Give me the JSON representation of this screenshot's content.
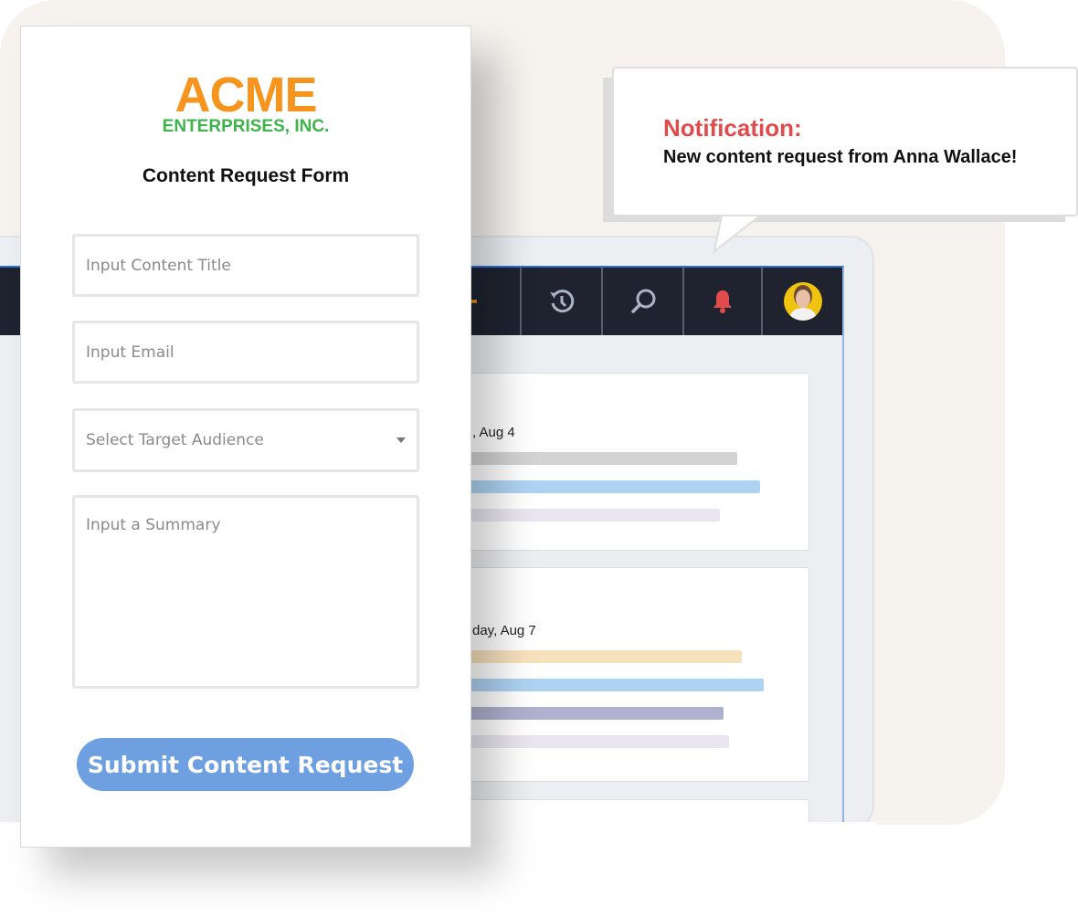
{
  "form": {
    "logo_main": "ACME",
    "logo_sub": "ENTERPRISES, INC.",
    "title": "Content Request Form",
    "content_title_placeholder": "Input Content Title",
    "email_placeholder": "Input Email",
    "audience_placeholder": "Select Target Audience",
    "summary_placeholder": "Input a Summary",
    "submit_label": "Submit Content Request"
  },
  "notification": {
    "title": "Notification:",
    "message": "New content request from Anna Wallace!"
  },
  "nav": {
    "icons": [
      "plus-icon",
      "history-icon",
      "search-icon",
      "bell-icon",
      "avatar"
    ]
  },
  "cards": [
    {
      "date": ", Aug 4",
      "bars": [
        {
          "color": "#d3d3d3"
        },
        {
          "color": "#aed3f2"
        },
        {
          "color": "#e9e6f1"
        }
      ]
    },
    {
      "date": "day, Aug 7",
      "bars": [
        {
          "color": "#f7e1bd"
        },
        {
          "color": "#aed3f2"
        },
        {
          "color": "#afb2cf"
        },
        {
          "color": "#e9e6f1"
        }
      ]
    }
  ],
  "colors": {
    "accent": "#f7941d",
    "brand_green": "#3fb44a",
    "notification": "#e24b4b",
    "button": "#6ea0e1",
    "nav": "#1f2330"
  }
}
